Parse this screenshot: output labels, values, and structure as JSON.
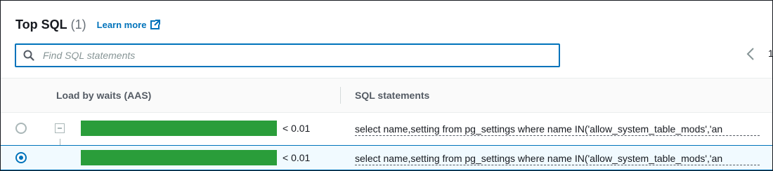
{
  "header": {
    "title": "Top SQL",
    "count": "(1)",
    "learn_more": "Learn more"
  },
  "search": {
    "placeholder": "Find SQL statements",
    "value": ""
  },
  "pagination": {
    "current_page": "1"
  },
  "table": {
    "columns": [
      "Load by waits (AAS)",
      "SQL statements"
    ],
    "rows": [
      {
        "selected": false,
        "expanded": true,
        "load_fraction": 1.0,
        "load_value": "< 0.01",
        "sql": "select name,setting from pg_settings where name IN('allow_system_table_mods','an"
      },
      {
        "selected": true,
        "child": true,
        "load_fraction": 1.0,
        "load_value": "< 0.01",
        "sql": "select name,setting from pg_settings where name IN('allow_system_table_mods','an"
      }
    ]
  },
  "colors": {
    "accent": "#0073bb",
    "bar": "#2a9d3a"
  },
  "icons": {
    "search": "search-icon",
    "external": "external-link-icon",
    "prev": "chevron-left-icon",
    "collapse": "collapse-icon"
  }
}
